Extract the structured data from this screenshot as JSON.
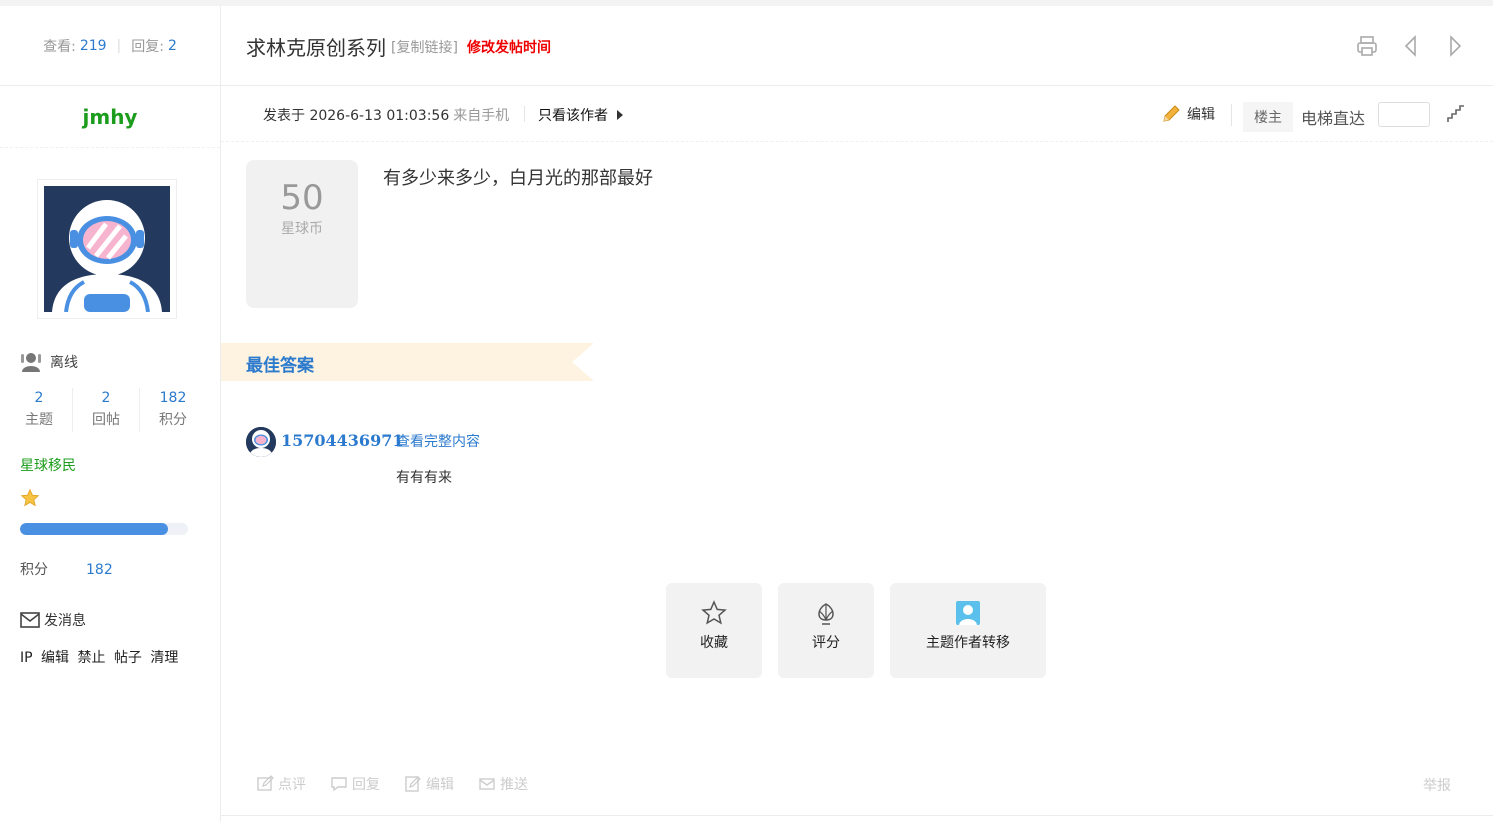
{
  "stats": {
    "views_label": "查看:",
    "views": "219",
    "replies_label": "回复:",
    "replies": "2"
  },
  "author": {
    "username": "jmhy",
    "status": "离线",
    "counts": [
      {
        "value": "2",
        "label": "主题"
      },
      {
        "value": "2",
        "label": "回帖"
      },
      {
        "value": "182",
        "label": "积分"
      }
    ],
    "rank": "星球移民",
    "progress": 0.88,
    "score_label": "积分",
    "score": "182",
    "send_message": "发消息",
    "admin_links": [
      "IP",
      "编辑",
      "禁止",
      "帖子",
      "清理"
    ]
  },
  "thread": {
    "title": "求林克原创系列",
    "copy_link": "[复制链接]",
    "modify_time": "修改发帖时间"
  },
  "post": {
    "time": "发表于 2026-6-13 01:03:56",
    "source": "来自手机",
    "only_author": "只看该作者",
    "edit": "编辑",
    "floor": "楼主",
    "elevator": "电梯直达",
    "reward_value": "50",
    "reward_unit": "星球币",
    "content": "有多少来多少，白月光的那部最好"
  },
  "best_answer": {
    "label": "最佳答案",
    "user": "15704436971",
    "view_full": "查看完整内容",
    "text": "有有有来"
  },
  "actions": {
    "favorite": "收藏",
    "rate": "评分",
    "transfer": "主题作者转移"
  },
  "bottom": {
    "comment": "点评",
    "reply": "回复",
    "edit": "编辑",
    "push": "推送",
    "report": "举报"
  },
  "colors": {
    "link": "#2b7acd",
    "username": "#1c9c1c",
    "alert": "#ee0000",
    "banner": "#fdf3e0"
  }
}
